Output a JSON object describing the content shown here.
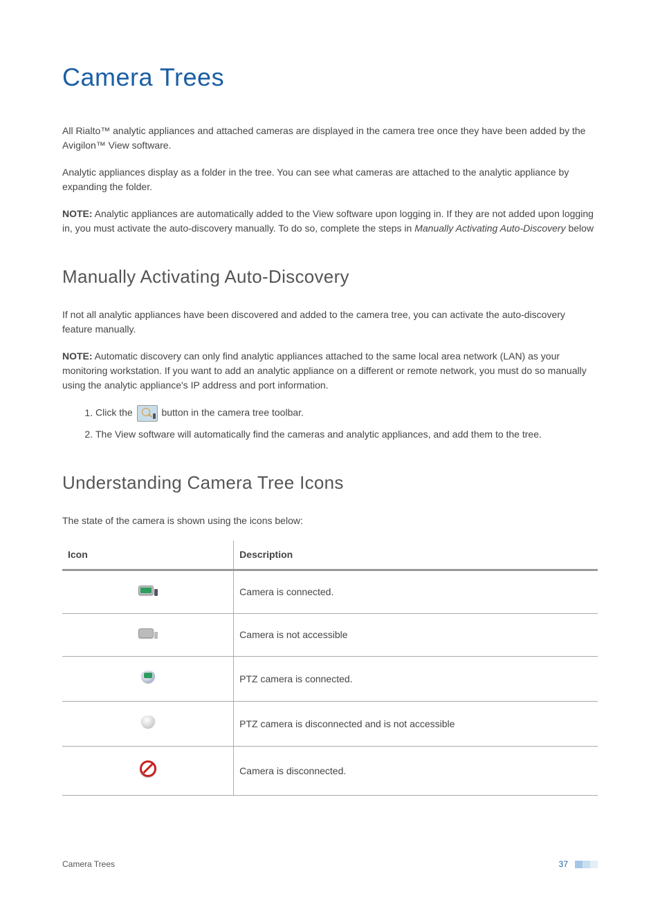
{
  "title": "Camera Trees",
  "intro1": "All Rialto™ analytic appliances and attached cameras are displayed in the camera tree once they have been added by the Avigilon™ View software.",
  "intro2": "Analytic appliances display as a folder in the tree. You can see what cameras are attached to the analytic appliance by expanding the folder.",
  "note1label": "NOTE:",
  "note1text": " Analytic appliances are automatically added to the View software upon logging in. If they are not added upon logging in, you must activate the auto-discovery manually. To do so, complete the steps in ",
  "note1italic": "Manually Activating Auto-Discovery",
  "note1after": " below",
  "section1title": "Manually Activating Auto-Discovery",
  "section1para": "If not all analytic appliances have been discovered and added to the camera tree, you can activate the auto-discovery feature manually.",
  "note2label": "NOTE:",
  "note2text": " Automatic discovery can only find analytic appliances attached to the same local area network (LAN) as your monitoring workstation. If you want to add an analytic appliance on a different or remote network, you must do so manually using the analytic appliance's IP address and port information.",
  "step1before": "Click the ",
  "step1after": " button in the camera tree toolbar.",
  "step2": "The View software will automatically find the cameras and analytic appliances, and add them to the tree.",
  "section2title": "Understanding Camera Tree Icons",
  "section2para": "The state of the camera is shown using the icons below:",
  "table": {
    "headers": {
      "icon": "Icon",
      "desc": "Description"
    },
    "rows": [
      {
        "desc": "Camera is connected."
      },
      {
        "desc": "Camera is not accessible"
      },
      {
        "desc": "PTZ camera is connected."
      },
      {
        "desc": "PTZ camera is disconnected and is not accessible"
      },
      {
        "desc": "Camera is disconnected."
      }
    ]
  },
  "footer": {
    "left": "Camera Trees",
    "page": "37"
  }
}
